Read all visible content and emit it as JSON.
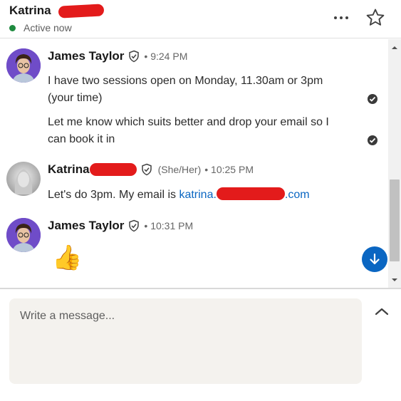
{
  "header": {
    "contact_name": "Katrina",
    "status": "Active now"
  },
  "messages": [
    {
      "sender": "James Taylor",
      "time": "• 9:24 PM",
      "bodies": [
        "I have two sessions open on Monday, 11.30am or 3pm (your time)",
        "Let me know which suits better and drop your email so I can book it in"
      ]
    },
    {
      "sender": "Katrina",
      "pronouns": "(She/Her)",
      "time": "• 10:25 PM",
      "body_prefix": "Let's do 3pm. My email is ",
      "email_start": "katrina.",
      "email_end": ".com"
    },
    {
      "sender": "James Taylor",
      "time": "• 10:31 PM",
      "emoji": "👍"
    }
  ],
  "composer": {
    "placeholder": "Write a message..."
  },
  "icons": {
    "more": "more-horizontal-icon",
    "star": "star-icon",
    "verified": "verified-shield-icon",
    "read": "read-receipt-check-icon",
    "jump": "arrow-down-icon",
    "expand": "chevron-up-icon"
  },
  "colors": {
    "accent": "#0a66c2",
    "online": "#1e8a3f",
    "redaction": "#e31b1b",
    "composer_bg": "#f4f2ee"
  }
}
